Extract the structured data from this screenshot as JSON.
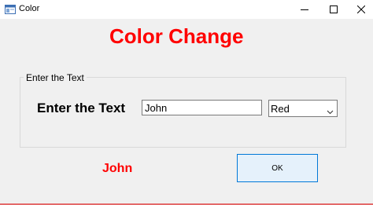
{
  "window": {
    "title": "Color",
    "icon": "form-window-icon",
    "controls": [
      "minimize-icon",
      "maximize-icon",
      "close-icon"
    ]
  },
  "main": {
    "heading": "Color Change",
    "heading_color": "#ff0000"
  },
  "group": {
    "caption": "Enter the Text",
    "label": "Enter the Text",
    "text_input_value": "John",
    "color_select_value": "Red"
  },
  "result": {
    "text": "John",
    "color": "#ff0000"
  },
  "ok_button": {
    "label": "OK",
    "accent": "#0078d7"
  }
}
